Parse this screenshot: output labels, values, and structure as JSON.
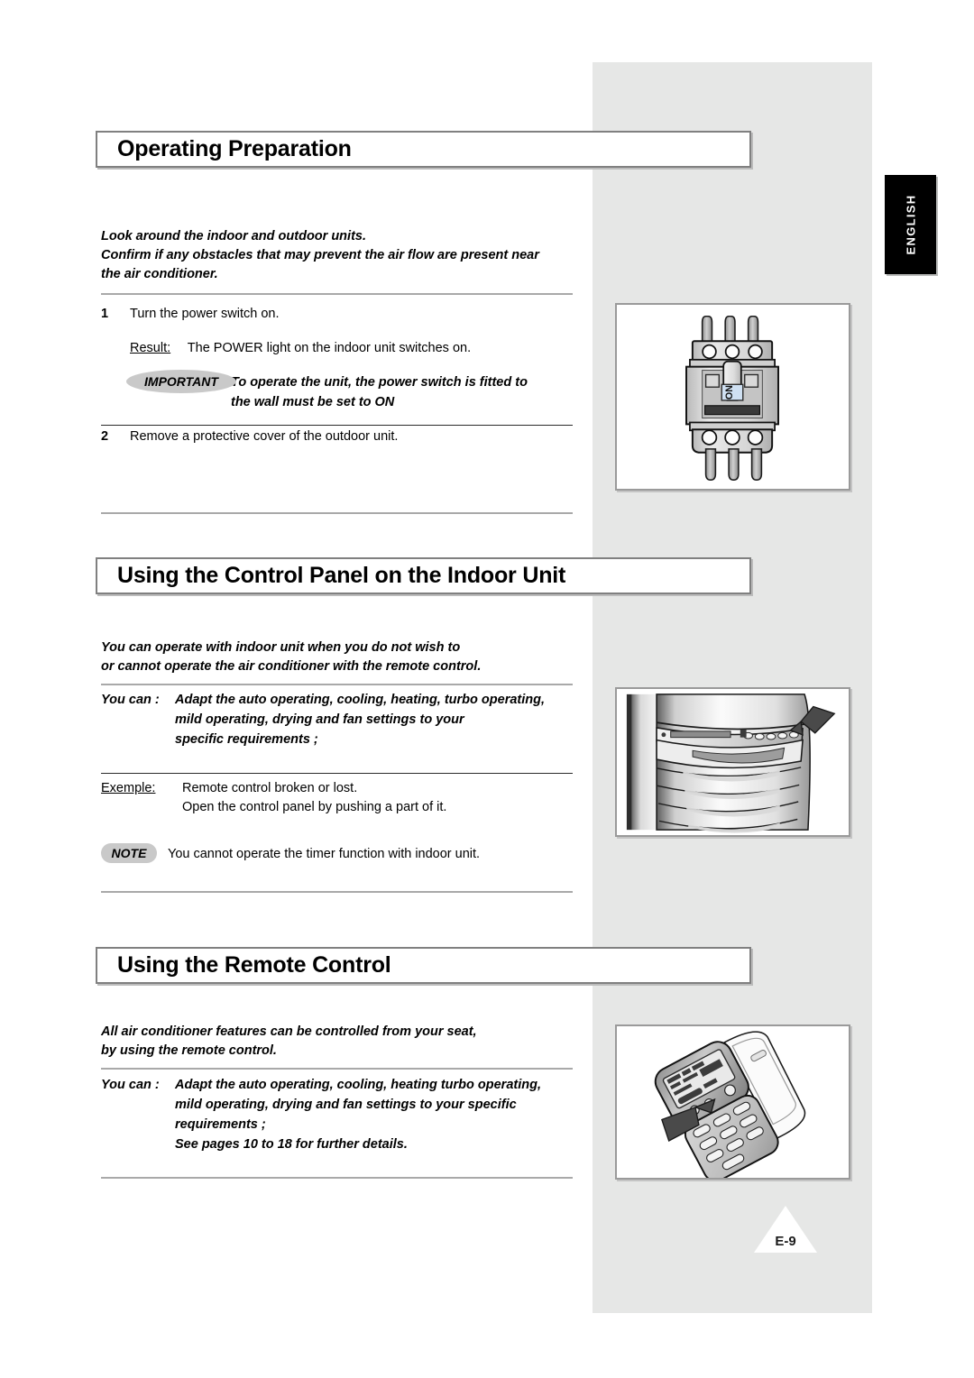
{
  "page": {
    "language_tab": "ENGLISH",
    "page_number": "E-9"
  },
  "sections": [
    {
      "id": "operating-preparation",
      "title": "Operating Preparation",
      "intro": [
        "Look around the indoor and outdoor units.",
        "Confirm if any obstacles that may prevent the air flow are present near",
        "the air conditioner."
      ],
      "steps": [
        {
          "num": "1",
          "text": "Turn the power switch on."
        },
        {
          "num": "2",
          "text": "Remove a protective cover of the outdoor unit."
        }
      ],
      "result": {
        "label": "Result:",
        "text": "The POWER light on the indoor unit switches on."
      },
      "important": {
        "badge": "IMPORTANT",
        "lines": [
          "To operate the unit, the power switch is fitted to",
          "the wall must be set to ON"
        ]
      },
      "figure": {
        "name": "circuit-breaker-illustration",
        "switch_label": "ON"
      }
    },
    {
      "id": "using-control-panel",
      "title": "Using the Control Panel on the Indoor Unit",
      "intro": [
        "You can operate with indoor unit when you do not wish to",
        "or cannot operate the air conditioner with the remote control."
      ],
      "youcan": {
        "label": "You can :",
        "lines": [
          "Adapt the auto operating, cooling, heating, turbo operating,",
          "mild operating, drying and fan settings to your",
          "specific requirements ;"
        ]
      },
      "exemple": {
        "label": "Exemple:",
        "lines": [
          "Remote control broken or lost.",
          "Open the control panel by pushing a part of it."
        ]
      },
      "note": {
        "badge": "NOTE",
        "text": "You cannot operate the timer function with indoor unit."
      },
      "figure": {
        "name": "indoor-unit-control-panel-illustration"
      }
    },
    {
      "id": "using-remote-control",
      "title": "Using the Remote Control",
      "intro": [
        "All air conditioner features can be controlled from your seat,",
        "by using the remote control."
      ],
      "youcan": {
        "label": "You can :",
        "lines": [
          "Adapt the auto operating, cooling, heating turbo operating,",
          "mild operating, drying and fan settings to your specific",
          "requirements ;",
          "See pages 10 to 18 for further details."
        ]
      },
      "figure": {
        "name": "remote-control-illustration"
      }
    }
  ],
  "colors": {
    "band": "#e6e7e6",
    "rule": "#a9a9a9",
    "badge": "#c9c9c9",
    "frame": "#9a9a9a"
  }
}
